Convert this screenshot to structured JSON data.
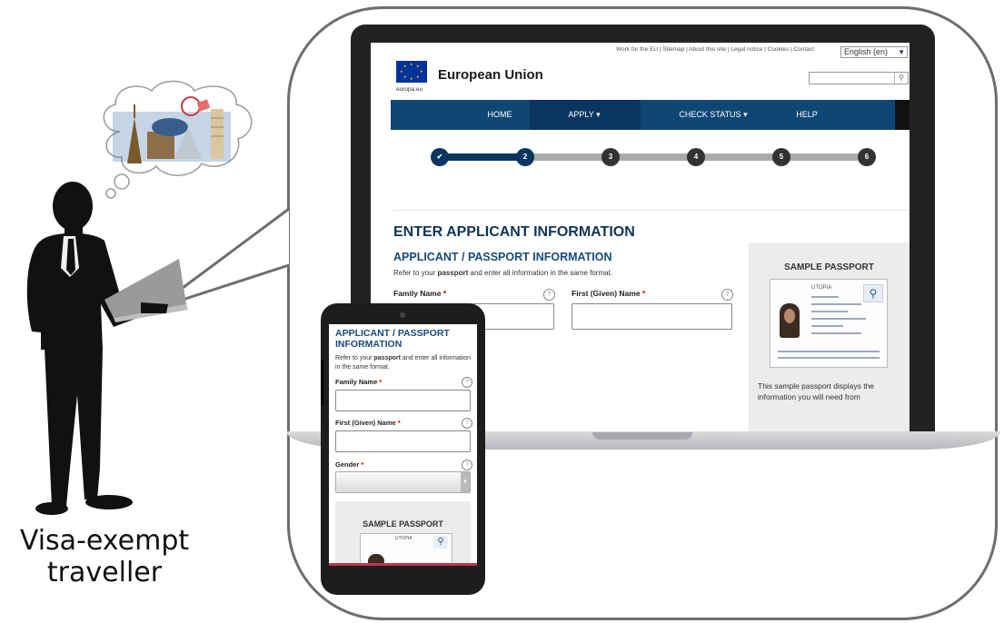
{
  "caption": {
    "line1": "Visa-exempt",
    "line2": "traveller"
  },
  "site": {
    "utility_links": "Work for the EU | Sitemap | About this site | Legal notice | Cookies | Contact",
    "language": "English (en)",
    "logo_sub": "europa.eu",
    "title": "European Union",
    "nav": {
      "home": "HOME",
      "apply": "APPLY ▾",
      "check_status": "CHECK STATUS ▾",
      "help": "HELP"
    },
    "steps": [
      "✔",
      "2",
      "3",
      "4",
      "5",
      "6"
    ],
    "page_heading": "ENTER APPLICANT INFORMATION",
    "section_heading": "APPLICANT / PASSPORT INFORMATION",
    "instruction_pre": "Refer to your ",
    "instruction_bold": "passport",
    "instruction_post": " and enter all information in the same format.",
    "family_name_label": "Family Name",
    "first_name_label": "First (Given) Name",
    "required_mark": "*",
    "help_glyph": "?",
    "sample_title": "SAMPLE PASSPORT",
    "passport_country": "UTOPIA",
    "sample_text": "This sample passport displays the information you will need from"
  },
  "phone": {
    "section_heading": "APPLICANT / PASSPORT INFORMATION",
    "instruction_pre": "Refer to your ",
    "instruction_bold": "passport",
    "instruction_post": " and enter all information in the same format.",
    "family_name_label": "Family Name",
    "first_name_label": "First (Given) Name",
    "gender_label": "Gender",
    "required_mark": "*",
    "help_glyph": "?",
    "sample_title": "SAMPLE PASSPORT",
    "passport_country": "UTOPIA"
  },
  "colors": {
    "eu_blue": "#003399",
    "nav_blue": "#0f4774",
    "heading_blue": "#164a78",
    "step_active": "#0a3561"
  }
}
